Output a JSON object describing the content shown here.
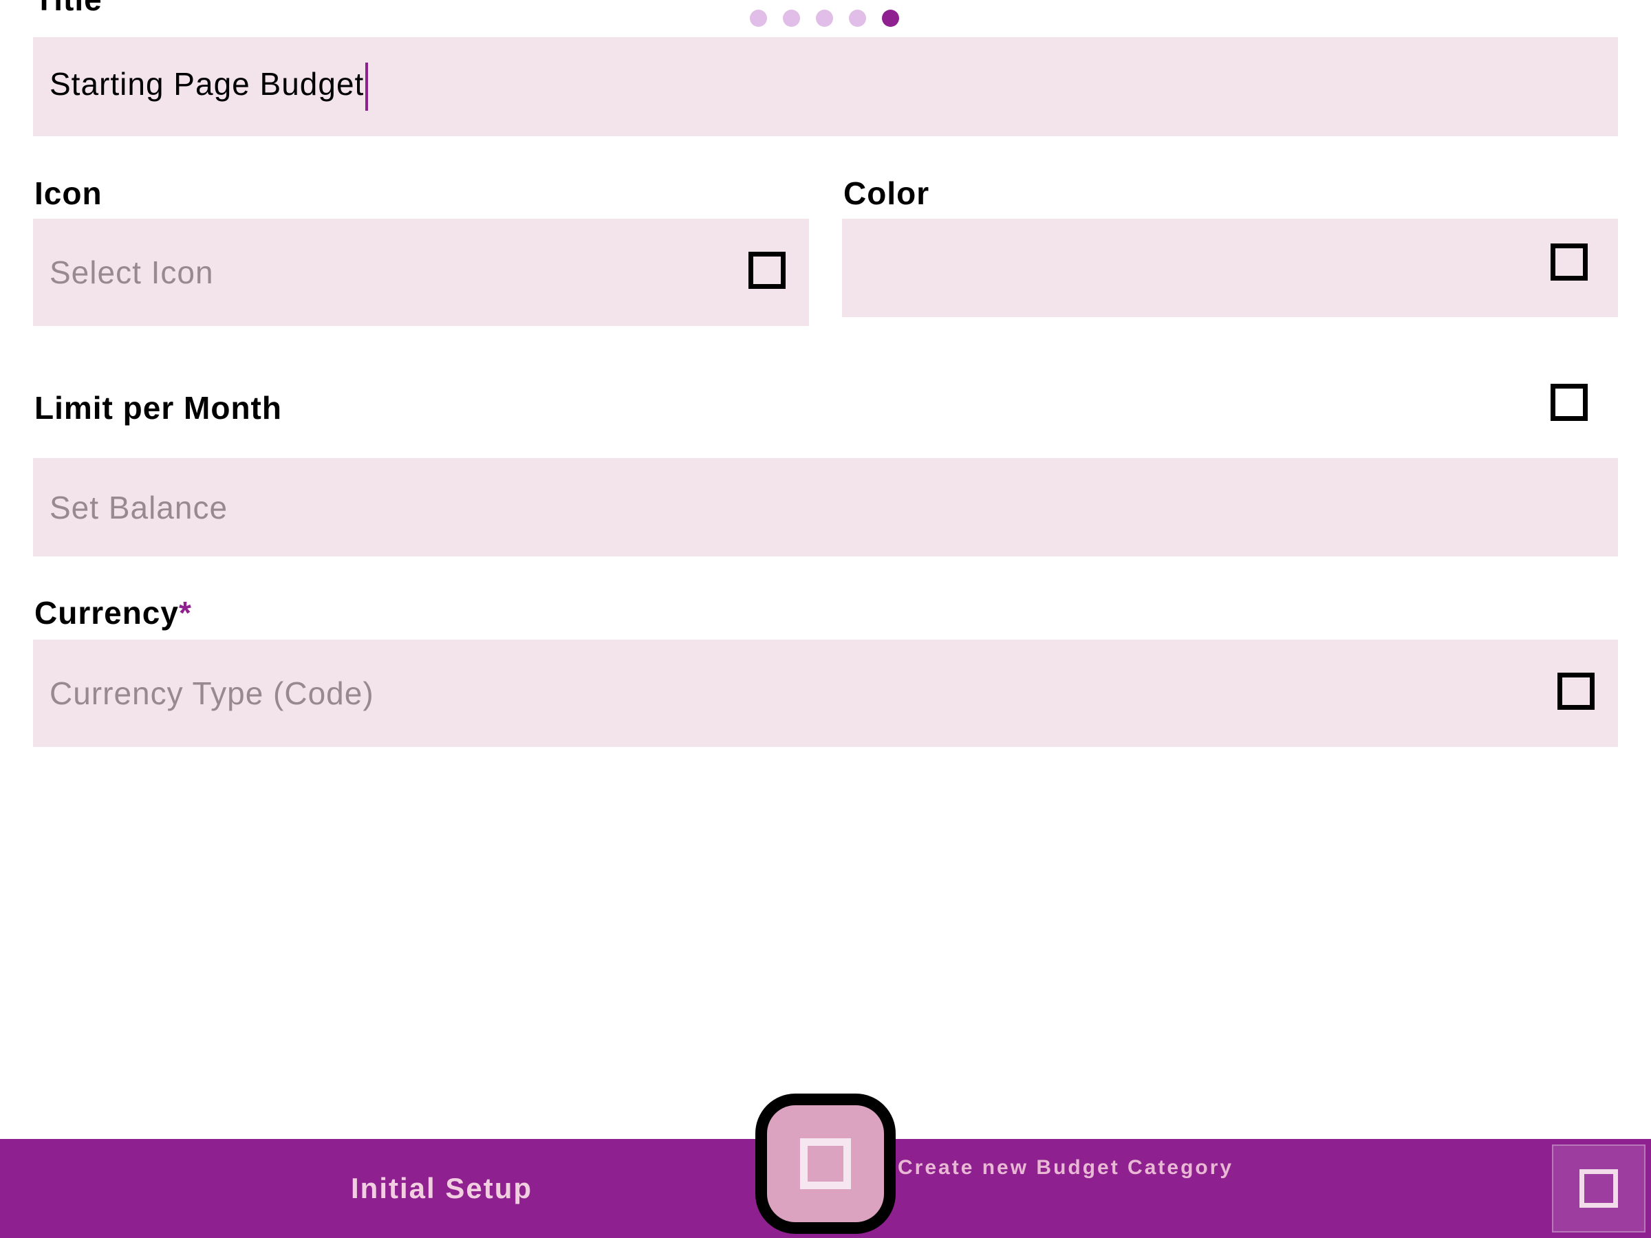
{
  "pager": {
    "total": 5,
    "active_index": 4
  },
  "form": {
    "title": {
      "label": "Title",
      "value": "Starting Page Budget"
    },
    "icon": {
      "label": "Icon",
      "placeholder": "Select Icon",
      "icon": "square-icon"
    },
    "color": {
      "label": "Color",
      "value": "",
      "icon": "square-icon"
    },
    "limit": {
      "label": "Limit per Month",
      "placeholder": "Set Balance",
      "icon": "square-icon"
    },
    "currency": {
      "label": "Currency",
      "required_mark": "*",
      "placeholder": "Currency Type (Code)",
      "icon": "square-icon"
    }
  },
  "bottom_bar": {
    "tab_label": "Initial Setup",
    "fab_hint": "Create new Budget Category",
    "fab_icon": "square-icon",
    "corner_icon": "square-icon"
  },
  "colors": {
    "accent": "#8e208f",
    "field_bg": "#f3e3ea",
    "dot_inactive": "#e1bee7",
    "fab_bg": "#dba3c0"
  }
}
